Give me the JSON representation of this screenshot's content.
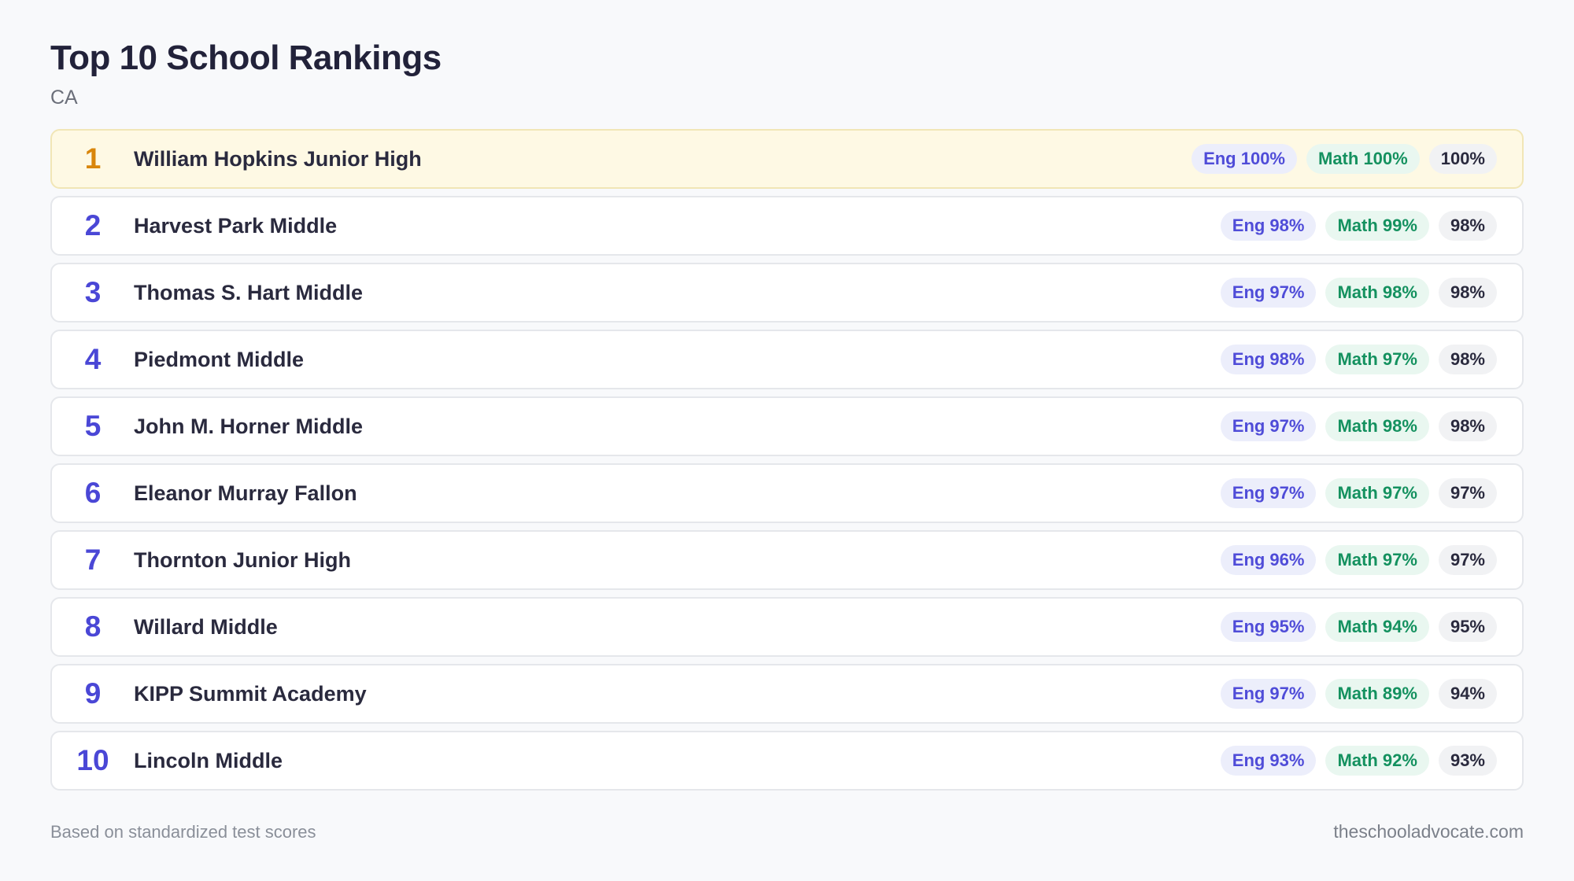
{
  "header": {
    "title": "Top 10 School Rankings",
    "subtitle": "CA"
  },
  "colors": {
    "page_background": "#f8f9fb",
    "rank_accent": "#4a47d6",
    "top_rank_accent": "#d9860b",
    "top_row_background": "#fef9e4",
    "eng_text": "#4f4cd8",
    "eng_background": "#eceefb",
    "math_text": "#14915f",
    "math_background": "#e9f7f0"
  },
  "rankings": [
    {
      "rank": "1",
      "school": "William Hopkins Junior High",
      "eng": "Eng 100%",
      "math": "Math 100%",
      "total": "100%"
    },
    {
      "rank": "2",
      "school": "Harvest Park Middle",
      "eng": "Eng 98%",
      "math": "Math 99%",
      "total": "98%"
    },
    {
      "rank": "3",
      "school": "Thomas S. Hart Middle",
      "eng": "Eng 97%",
      "math": "Math 98%",
      "total": "98%"
    },
    {
      "rank": "4",
      "school": "Piedmont Middle",
      "eng": "Eng 98%",
      "math": "Math 97%",
      "total": "98%"
    },
    {
      "rank": "5",
      "school": "John M. Horner Middle",
      "eng": "Eng 97%",
      "math": "Math 98%",
      "total": "98%"
    },
    {
      "rank": "6",
      "school": "Eleanor Murray Fallon",
      "eng": "Eng 97%",
      "math": "Math 97%",
      "total": "97%"
    },
    {
      "rank": "7",
      "school": "Thornton Junior High",
      "eng": "Eng 96%",
      "math": "Math 97%",
      "total": "97%"
    },
    {
      "rank": "8",
      "school": "Willard Middle",
      "eng": "Eng 95%",
      "math": "Math 94%",
      "total": "95%"
    },
    {
      "rank": "9",
      "school": "KIPP Summit Academy",
      "eng": "Eng 97%",
      "math": "Math 89%",
      "total": "94%"
    },
    {
      "rank": "10",
      "school": "Lincoln Middle",
      "eng": "Eng 93%",
      "math": "Math 92%",
      "total": "93%"
    }
  ],
  "footer": {
    "note": "Based on standardized test scores",
    "site": "theschooladvocate.com"
  }
}
